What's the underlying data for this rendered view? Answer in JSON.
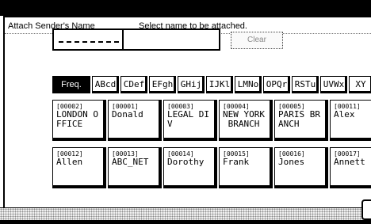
{
  "header": {
    "title": "Attach Sender's Name",
    "instruction": "Select name to be attached."
  },
  "entry": {
    "value": "",
    "button_label": "Clear"
  },
  "tabs": [
    "Freq.",
    "ABcd",
    "CDef",
    "EFgh",
    "GHij",
    "IJKl",
    "LMNo",
    "OPQr",
    "RSTu",
    "UVWx",
    "XY"
  ],
  "names_row1": [
    {
      "num": "[00002]",
      "name": "LONDON O\nFFICE"
    },
    {
      "num": "[00001]",
      "name": "Donald"
    },
    {
      "num": "[00003]",
      "name": "LEGAL DI\nV"
    },
    {
      "num": "[00004]",
      "name": "NEW YORK\n BRANCH"
    },
    {
      "num": "[00005]",
      "name": "PARIS BR\nANCH"
    },
    {
      "num": "[00011]",
      "name": "Alex"
    }
  ],
  "names_row2": [
    {
      "num": "[00012]",
      "name": "Allen"
    },
    {
      "num": "[00013]",
      "name": "ABC_NET"
    },
    {
      "num": "[00014]",
      "name": "Dorothy"
    },
    {
      "num": "[00015]",
      "name": "Frank"
    },
    {
      "num": "[00016]",
      "name": "Jones"
    },
    {
      "num": "[00017]",
      "name": "Annett"
    }
  ]
}
